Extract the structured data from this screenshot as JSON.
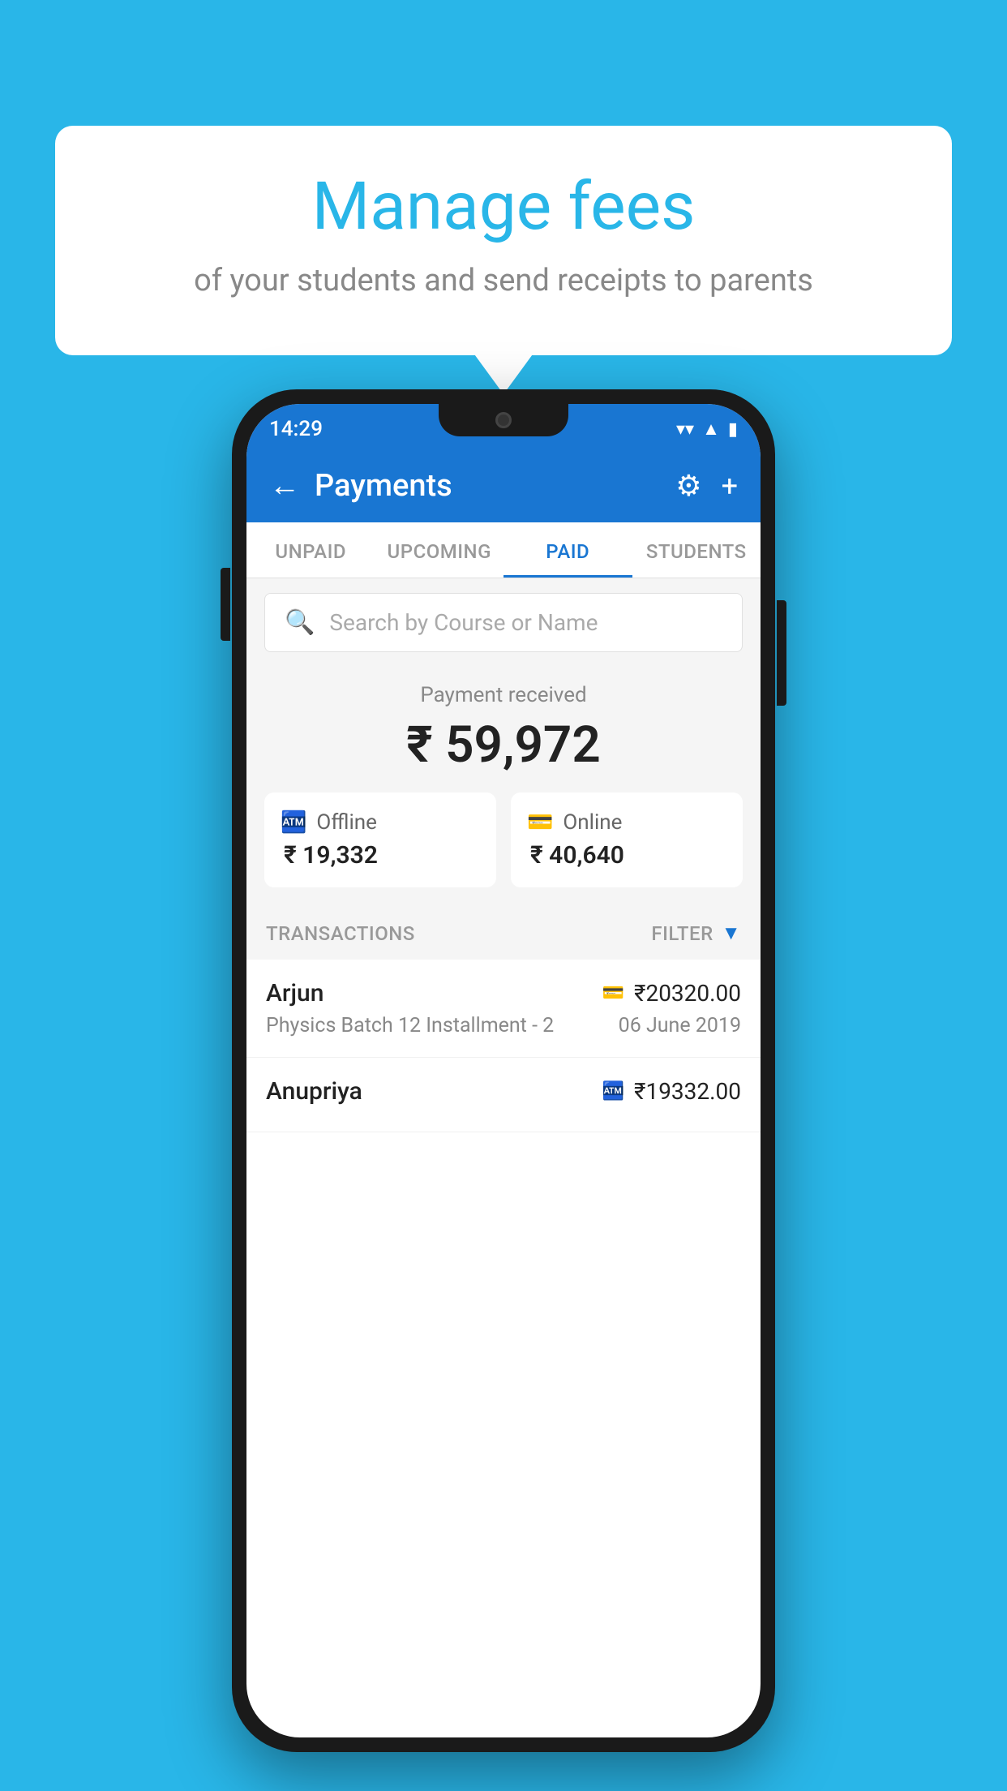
{
  "background_color": "#29b6e8",
  "bubble": {
    "title": "Manage fees",
    "subtitle": "of your students and send receipts to parents"
  },
  "status_bar": {
    "time": "14:29",
    "wifi": "▼",
    "signal": "▲",
    "battery": "▮"
  },
  "header": {
    "title": "Payments",
    "back_label": "←",
    "gear_label": "⚙",
    "plus_label": "+"
  },
  "tabs": [
    {
      "label": "UNPAID",
      "active": false
    },
    {
      "label": "UPCOMING",
      "active": false
    },
    {
      "label": "PAID",
      "active": true
    },
    {
      "label": "STUDENTS",
      "active": false
    }
  ],
  "search": {
    "placeholder": "Search by Course or Name"
  },
  "payment_summary": {
    "label": "Payment received",
    "amount": "₹ 59,972",
    "offline": {
      "type": "Offline",
      "amount": "₹ 19,332"
    },
    "online": {
      "type": "Online",
      "amount": "₹ 40,640"
    }
  },
  "transactions_header": {
    "label": "TRANSACTIONS",
    "filter_label": "FILTER"
  },
  "transactions": [
    {
      "name": "Arjun",
      "course": "Physics Batch 12 Installment - 2",
      "amount": "₹20320.00",
      "date": "06 June 2019",
      "payment_type": "online"
    },
    {
      "name": "Anupriya",
      "course": "",
      "amount": "₹19332.00",
      "date": "",
      "payment_type": "offline"
    }
  ]
}
